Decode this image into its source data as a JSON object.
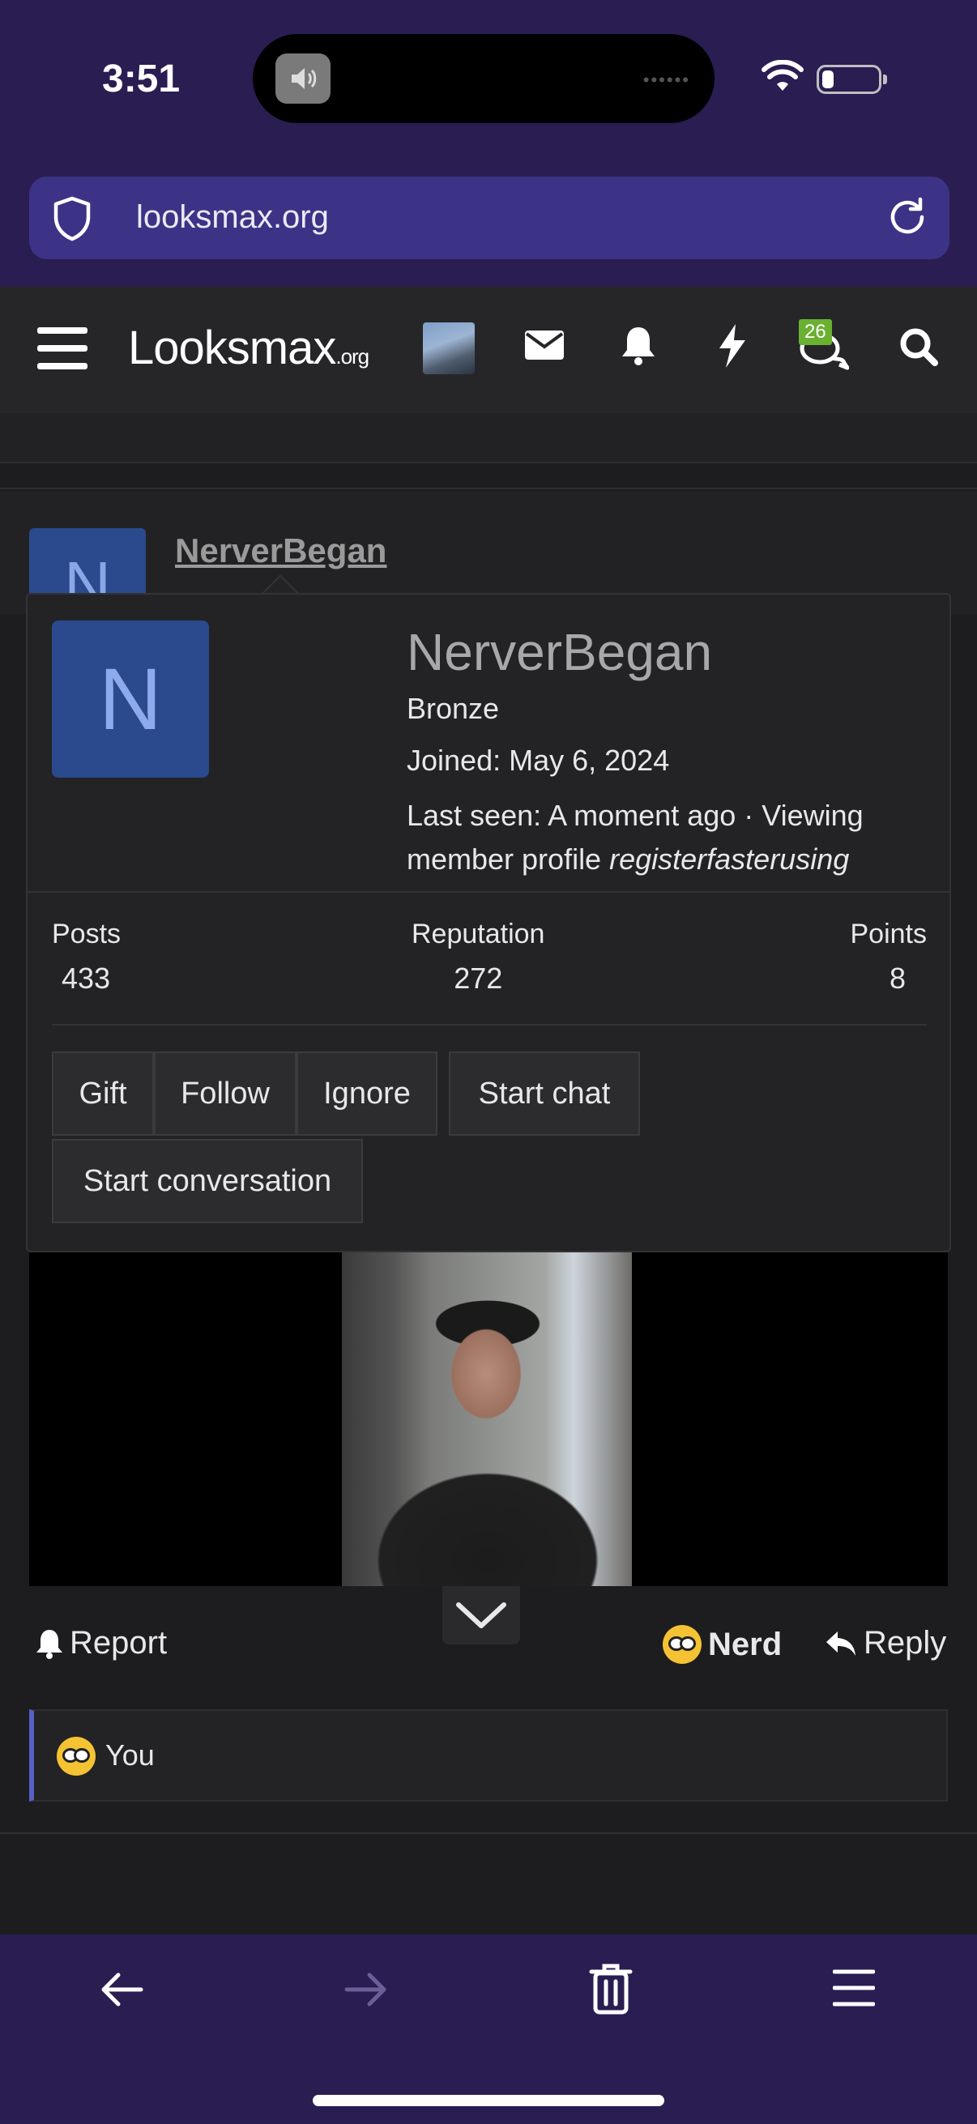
{
  "status_bar": {
    "time": "3:51"
  },
  "browser": {
    "url": "looksmax.org"
  },
  "site_nav": {
    "logo_main": "Looksmax",
    "logo_suffix": ".org",
    "chat_badge": "26"
  },
  "post": {
    "avatar_letter": "N",
    "username": "NerverBegan"
  },
  "popover": {
    "avatar_letter": "N",
    "name": "NerverBegan",
    "rank": "Bronze",
    "joined": "Joined: May 6, 2024",
    "last_seen_prefix": "Last seen: A moment ago · Viewing member profile",
    "last_seen_user": "registerfasterusing",
    "stats": {
      "posts_label": "Posts",
      "posts_value": "433",
      "reputation_label": "Reputation",
      "reputation_value": "272",
      "points_label": "Points",
      "points_value": "8"
    },
    "buttons": {
      "gift": "Gift",
      "follow": "Follow",
      "ignore": "Ignore",
      "start_chat": "Start chat",
      "start_conversation": "Start conversation"
    }
  },
  "actions": {
    "report": "Report",
    "reaction": "Nerd",
    "reply": "Reply"
  },
  "reactions_summary": {
    "text": "You"
  },
  "icons": [
    "speaker-icon",
    "wifi-icon",
    "battery-icon",
    "shield-icon",
    "reload-icon",
    "menu-icon",
    "mail-icon",
    "bell-icon",
    "bolt-icon",
    "chat-icon",
    "search-icon",
    "chevron-down-icon",
    "nerd-emoji-icon",
    "reply-icon",
    "back-icon",
    "forward-icon",
    "trash-icon",
    "browser-menu-icon"
  ],
  "colors": {
    "browser_chrome": "#2a1d52",
    "url_bar": "#3c3387",
    "avatar": "#2a4a8d",
    "badge": "#6ab031",
    "reaction_accent": "#5660c8"
  }
}
